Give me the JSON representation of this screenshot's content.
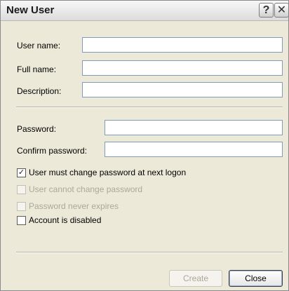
{
  "window": {
    "title": "New User",
    "help_glyph": "?",
    "close_glyph": "✕"
  },
  "form": {
    "user_name_label": "User name:",
    "user_name_value": "",
    "full_name_label": "Full name:",
    "full_name_value": "",
    "description_label": "Description:",
    "description_value": "",
    "password_label": "Password:",
    "password_value": "",
    "confirm_password_label": "Confirm password:",
    "confirm_password_value": ""
  },
  "options": [
    {
      "label": "User must change password at next logon",
      "checked": true,
      "enabled": true
    },
    {
      "label": "User cannot change password",
      "checked": false,
      "enabled": false
    },
    {
      "label": "Password never expires",
      "checked": false,
      "enabled": false
    },
    {
      "label": "Account is disabled",
      "checked": false,
      "enabled": true
    }
  ],
  "buttons": {
    "create_label": "Create",
    "close_label": "Close"
  },
  "icons": {
    "help": "help-icon",
    "close": "close-icon",
    "check": "checkmark-icon"
  }
}
